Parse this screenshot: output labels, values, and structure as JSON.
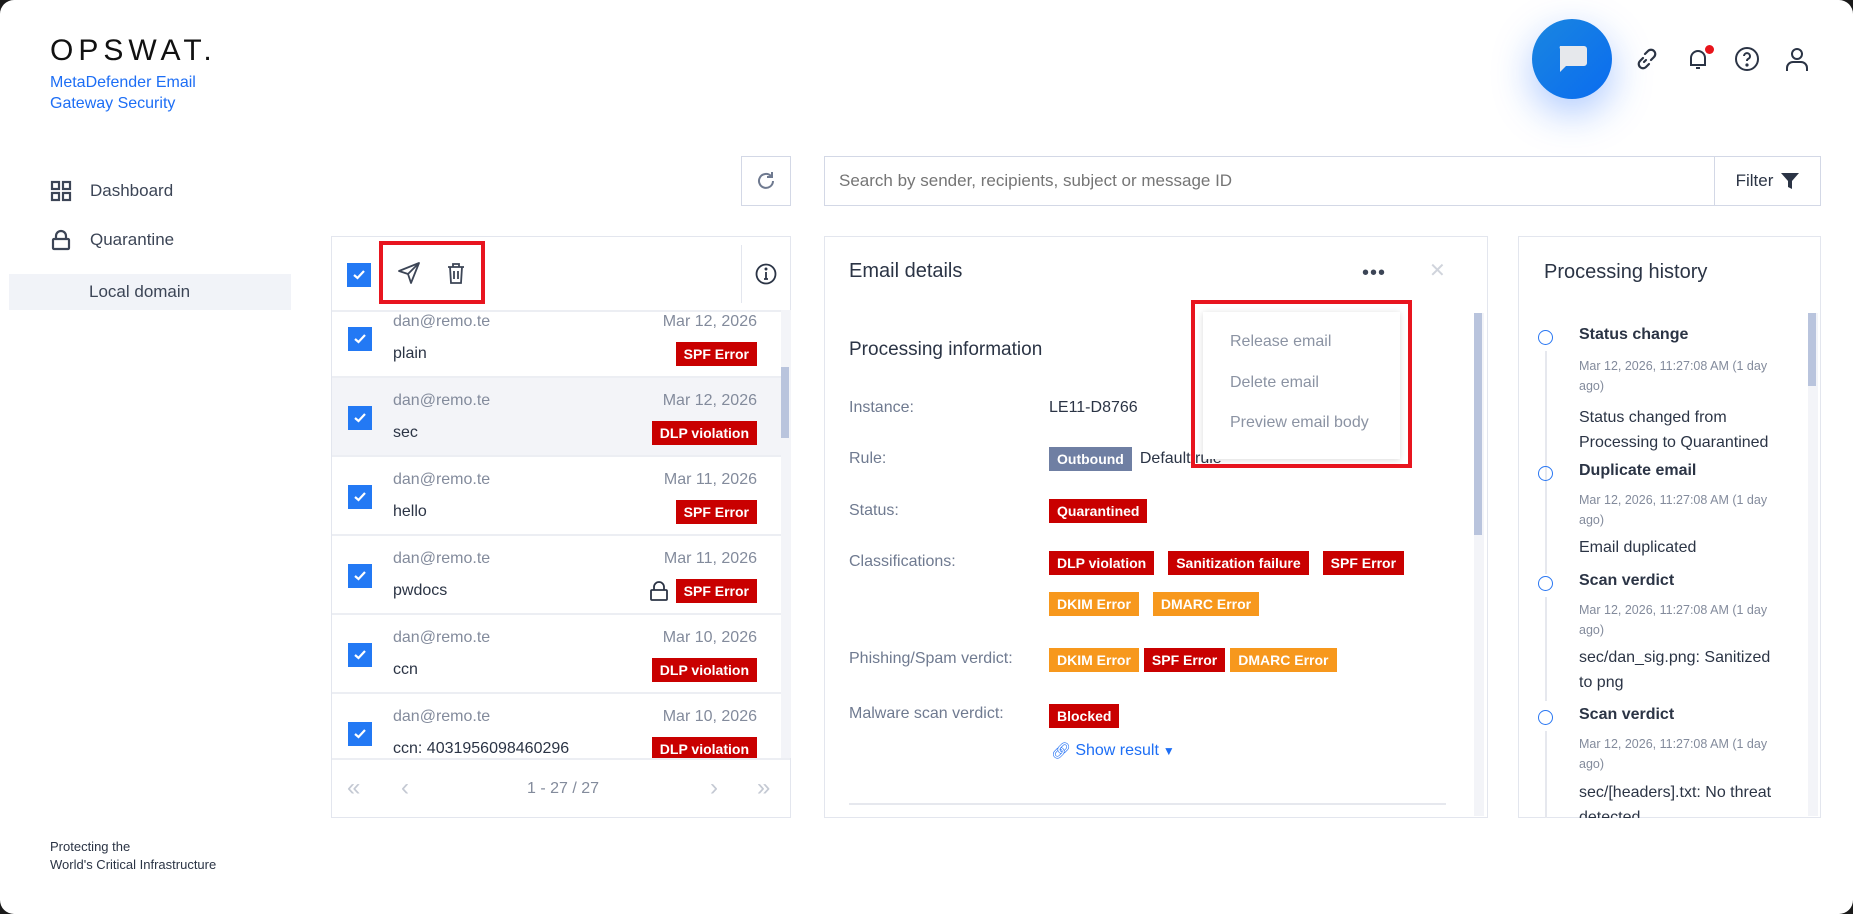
{
  "brand": {
    "logo": "OPSWAT.",
    "product": "MetaDefender Email Gateway Security",
    "tagline_1": "Protecting the",
    "tagline_2": "World's Critical Infrastructure"
  },
  "sidebar": {
    "items": [
      {
        "label": "Dashboard",
        "icon": "grid-icon"
      },
      {
        "label": "Quarantine",
        "icon": "lock-icon"
      }
    ],
    "sub_item": "Local domain"
  },
  "toolbar": {
    "search_placeholder": "Search by sender, recipients, subject or message ID",
    "filter_label": "Filter",
    "notification_dot_color": "#e8141b"
  },
  "list": {
    "rows": [
      {
        "sender": "dan@remo.te",
        "date": "Mar 12, 2026",
        "subject": "plain",
        "tags": [
          {
            "text": "SPF Error",
            "color": "red"
          }
        ],
        "locked": false,
        "selected": false
      },
      {
        "sender": "dan@remo.te",
        "date": "Mar 12, 2026",
        "subject": "sec",
        "tags": [
          {
            "text": "DLP violation",
            "color": "red"
          }
        ],
        "locked": false,
        "selected": true
      },
      {
        "sender": "dan@remo.te",
        "date": "Mar 11, 2026",
        "subject": "hello",
        "tags": [
          {
            "text": "SPF Error",
            "color": "red"
          }
        ],
        "locked": false,
        "selected": false
      },
      {
        "sender": "dan@remo.te",
        "date": "Mar 11, 2026",
        "subject": "pwdocs",
        "tags": [
          {
            "text": "SPF Error",
            "color": "red"
          }
        ],
        "locked": true,
        "selected": false
      },
      {
        "sender": "dan@remo.te",
        "date": "Mar 10, 2026",
        "subject": "ccn",
        "tags": [
          {
            "text": "DLP violation",
            "color": "red"
          }
        ],
        "locked": false,
        "selected": false
      },
      {
        "sender": "dan@remo.te",
        "date": "Mar 10, 2026",
        "subject": "ccn: 4031956098460296",
        "tags": [
          {
            "text": "DLP violation",
            "color": "red"
          }
        ],
        "locked": false,
        "selected": false
      }
    ],
    "pagination": "1 - 27 / 27"
  },
  "details": {
    "title": "Email details",
    "section": "Processing information",
    "instance_label": "Instance:",
    "instance": "LE11-D8766",
    "rule_label": "Rule:",
    "rule_tag": "Outbound",
    "rule_name": "Default rule",
    "status_label": "Status:",
    "status": "Quarantined",
    "classifications_label": "Classifications:",
    "classifications": [
      {
        "text": "DLP violation",
        "color": "red"
      },
      {
        "text": "Sanitization failure",
        "color": "red"
      },
      {
        "text": "SPF Error",
        "color": "red"
      },
      {
        "text": "DKIM Error",
        "color": "orange"
      },
      {
        "text": "DMARC Error",
        "color": "orange"
      }
    ],
    "phishing_label": "Phishing/Spam verdict:",
    "phishing": [
      {
        "text": "DKIM Error",
        "color": "orange"
      },
      {
        "text": "SPF Error",
        "color": "red"
      },
      {
        "text": "DMARC Error",
        "color": "orange"
      }
    ],
    "malware_label": "Malware scan verdict:",
    "malware": "Blocked",
    "show_result": "Show result",
    "menu": [
      "Release email",
      "Delete email",
      "Preview email body"
    ]
  },
  "history": {
    "title": "Processing history",
    "items": [
      {
        "title": "Status change",
        "time": "Mar 12, 2026, 11:27:08 AM (1 day ago)",
        "text": "Status changed from Processing to Quarantined"
      },
      {
        "title": "Duplicate email",
        "time": "Mar 12, 2026, 11:27:08 AM (1 day ago)",
        "text": "Email duplicated"
      },
      {
        "title": "Scan verdict",
        "time": "Mar 12, 2026, 11:27:08 AM (1 day ago)",
        "text": "sec/dan_sig.png: Sanitized to png"
      },
      {
        "title": "Scan verdict",
        "time": "Mar 12, 2026, 11:27:08 AM (1 day ago)",
        "text": "sec/[headers].txt: No threat detected"
      }
    ]
  }
}
